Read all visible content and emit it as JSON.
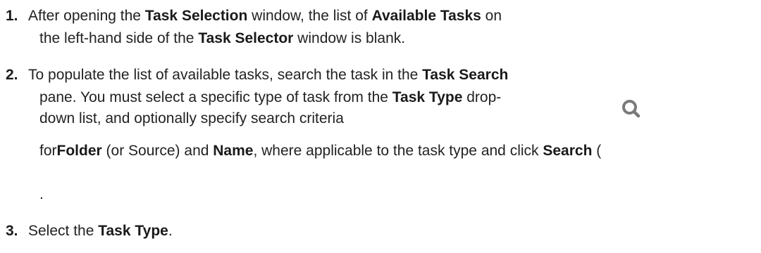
{
  "steps": [
    {
      "number": "1.",
      "lines": [
        {
          "t1": "After opening the ",
          "b1": "Task Selection",
          "t2": " window, the list of ",
          "b2": "Available Tasks",
          "t3": " on"
        },
        {
          "t1": "the left-hand side of the ",
          "b1": "Task Selector",
          "t2": " window is blank."
        }
      ]
    },
    {
      "number": "2.",
      "lines": [
        {
          "t1": "To populate the list of available tasks, search the task in the ",
          "b1": "Task Search"
        },
        {
          "t1": "pane. You must select a specific type of task from the ",
          "b1": "Task Type",
          "t2": " drop-"
        },
        {
          "t1": "down list, and optionally specify search criteria"
        },
        {
          "t1": "for",
          "b1": "Folder",
          "t2": " (or Source) and ",
          "b2": "Name",
          "t3": ", where applicable to the task type and click ",
          "b3": "Search",
          "t4": " ("
        },
        {
          "t1": "."
        }
      ],
      "icon": "search-icon"
    },
    {
      "number": "3.",
      "lines": [
        {
          "t1": "Select the ",
          "b1": "Task Type",
          "t2": "."
        }
      ]
    }
  ],
  "colors": {
    "text": "#222222",
    "icon": "#7a7a7a"
  }
}
